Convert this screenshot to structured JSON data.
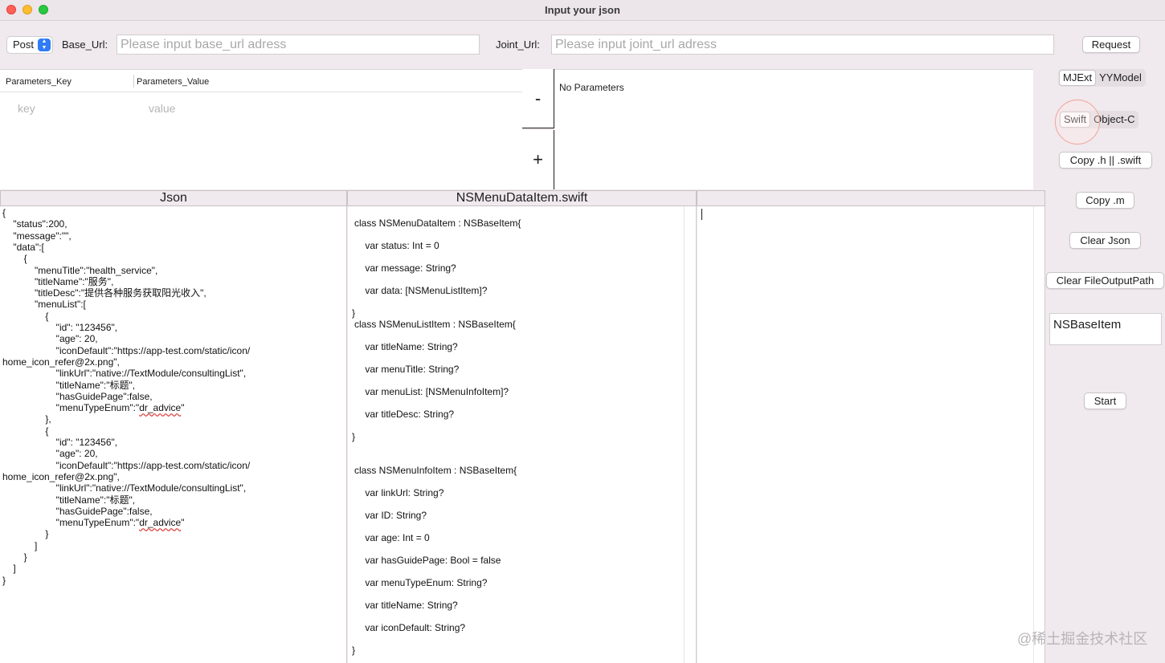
{
  "window": {
    "title": "Input your json"
  },
  "toolbar": {
    "method": "Post",
    "base_url_label": "Base_Url:",
    "base_url_placeholder": "Please input base_url adress",
    "joint_url_label": "Joint_Url:",
    "joint_url_placeholder": "Please input joint_url adress",
    "request_label": "Request"
  },
  "params": {
    "col_key": "Parameters_Key",
    "col_value": "Parameters_Value",
    "key_placeholder": "key",
    "value_placeholder": "value",
    "minus": "-",
    "plus": "+",
    "status": "No Parameters"
  },
  "headers": {
    "json": "Json",
    "code": "NSMenuDataItem.swift",
    "output": ""
  },
  "json_lines": [
    "{",
    "    \"status\":200,",
    "    \"message\":\"\",",
    "    \"data\":[",
    "        {",
    "            \"menuTitle\":\"health_service\",",
    "            \"titleName\":\"服务\",",
    "            \"titleDesc\":\"提供各种服务获取阳光收入\",",
    "            \"menuList\":[",
    "                {",
    "                    \"id\": \"123456\",",
    "                    \"age\": 20,",
    "                    \"iconDefault\":\"https://app-test.com/static/icon/",
    "home_icon_refer@2x.png\",",
    "                    \"linkUrl\":\"native://TextModule/consultingList\",",
    "                    \"titleName\":\"标题\",",
    "                    \"hasGuidePage\":false,",
    "                    \"menuTypeEnum\":\"dr_advice\"",
    "                },",
    "                {",
    "                    \"id\": \"123456\",",
    "                    \"age\": 20,",
    "                    \"iconDefault\":\"https://app-test.com/static/icon/",
    "home_icon_refer@2x.png\",",
    "                    \"linkUrl\":\"native://TextModule/consultingList\",",
    "                    \"titleName\":\"标题\",",
    "                    \"hasGuidePage\":false,",
    "                    \"menuTypeEnum\":\"dr_advice\"",
    "                }",
    "            ]",
    "        }",
    "    ]",
    "}"
  ],
  "code_lines": [
    "class NSMenuDataItem : NSBaseItem{",
    "    var status: Int = 0",
    "    var message: String?",
    "    var data: [NSMenuListItem]?",
    "}",
    "class NSMenuListItem : NSBaseItem{",
    "    var titleName: String?",
    "    var menuTitle: String?",
    "    var menuList: [NSMenuInfoItem]?",
    "    var titleDesc: String?",
    "}",
    "class NSMenuInfoItem : NSBaseItem{",
    "    var linkUrl: String?",
    "    var ID: String?",
    "    var age: Int = 0",
    "    var hasGuidePage: Bool = false",
    "    var menuTypeEnum: String?",
    "    var titleName: String?",
    "    var iconDefault: String?",
    "}"
  ],
  "sidebar": {
    "mjext": "MJExt",
    "yymodel": "YYModel",
    "swift": "Swift",
    "objc": "Object-C",
    "copy_h_swift": "Copy .h || .swift",
    "copy_m": "Copy .m",
    "clear_json": "Clear Json",
    "clear_file_output_path": "Clear FileOutputPath",
    "base_class": "NSBaseItem",
    "start": "Start"
  },
  "watermark": "@稀土掘金技术社区"
}
